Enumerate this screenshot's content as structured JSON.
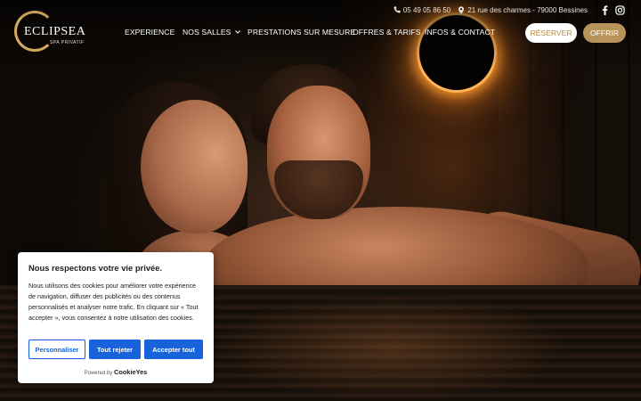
{
  "topbar": {
    "phone": "05 49 05 86 50",
    "address": "21 rue des charmes - 79000 Bessines",
    "phone_icon": "phone-icon",
    "location_icon": "location-pin-icon",
    "social": [
      "facebook-icon",
      "instagram-icon"
    ]
  },
  "logo": {
    "name": "ECLIPSEA",
    "tagline": "SPA PRIVATIF"
  },
  "nav": {
    "items": [
      {
        "label": "EXPERIENCE"
      },
      {
        "label": "NOS SALLES",
        "has_dropdown": true
      },
      {
        "label": "PRESTATIONS SUR MESURE"
      },
      {
        "label": "OFFRES & TARIFS"
      },
      {
        "label": "INFOS & CONTACT"
      }
    ],
    "reserve_label": "RÉSERVER",
    "offer_label": "OFFRIR"
  },
  "cookie": {
    "title": "Nous respectons votre vie privée.",
    "body": "Nous utilisons des cookies pour améliorer votre expérience de navigation, diffuser des publicités ou des contenus personnalisés et analyser notre trafic. En cliquant sur « Tout accepter », vous consentez à notre utilisation des cookies.",
    "customize_label": "Personnaliser",
    "reject_label": "Tout rejeter",
    "accept_label": "Accepter tout",
    "powered_prefix": "Powered by",
    "powered_brand": "CookieYes"
  },
  "colors": {
    "accent_gold": "#b8935a",
    "cookie_blue": "#1863dc"
  }
}
